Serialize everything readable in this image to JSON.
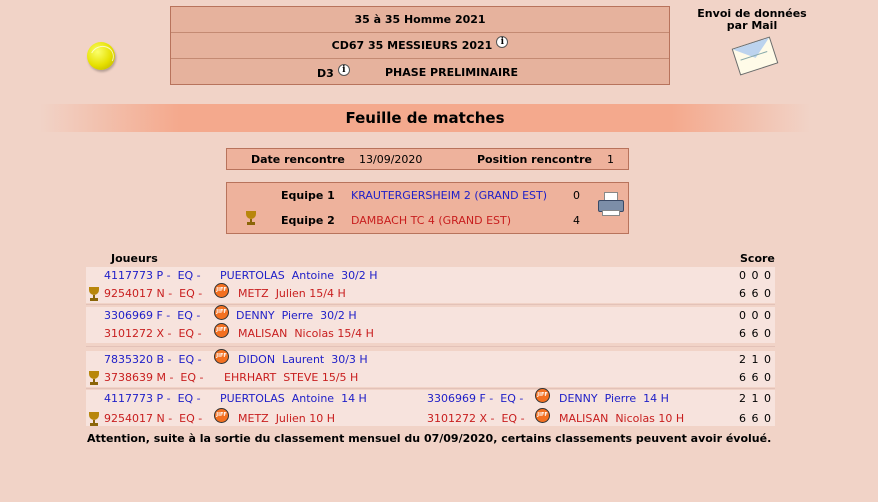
{
  "header": {
    "line1": "35  à 35  Homme  2021",
    "line2": "CD67 35 MESSIEURS 2021",
    "division": "D3",
    "phase": "PHASE PRELIMINAIRE",
    "info_glyph": "i"
  },
  "mail": {
    "label_line1": "Envoi de données",
    "label_line2": "par Mail"
  },
  "banner": {
    "title": "Feuille de matches"
  },
  "date_box": {
    "date_label": "Date rencontre",
    "date_value": "13/09/2020",
    "position_label": "Position rencontre",
    "position_value": "1"
  },
  "teams": [
    {
      "label": "Equipe 1",
      "name": "KRAUTERGERSHEIM 2 (GRAND EST)",
      "score": "0",
      "color": "#2020c8"
    },
    {
      "label": "Equipe 2",
      "name": "DAMBACH TC 4 (GRAND EST)",
      "score": "4",
      "color": "#c81e1e"
    }
  ],
  "table_headers": {
    "players": "Joueurs",
    "score": "Score"
  },
  "matches": [
    {
      "p1": {
        "id": "4117773 P -  EQ -",
        "name": "PUERTOLAS  Antoine  30/2 H",
        "score": "0 0 0"
      },
      "p2": {
        "id": "9254017 N -  EQ -",
        "name": "METZ  Julien 15/4 H",
        "score": "6 6 0"
      }
    },
    {
      "p1": {
        "id": "3306969 F -  EQ -",
        "name": "DENNY  Pierre  30/2 H",
        "score": "0 0 0"
      },
      "p2": {
        "id": "3101272 X -  EQ -",
        "name": "MALISAN  Nicolas 15/4 H",
        "score": "6 6 0"
      }
    },
    {
      "p1": {
        "id": "7835320 B -  EQ -",
        "name": "DIDON  Laurent  30/3 H",
        "score": "2 1 0"
      },
      "p2": {
        "id": "3738639 M -  EQ -",
        "name": "EHRHART  STEVE 15/5 H",
        "score": "6 6 0"
      }
    },
    {
      "p1": {
        "id": "4117773 P -  EQ -",
        "name": "PUERTOLAS  Antoine  14 H",
        "id_b": "3306969 F -  EQ -",
        "name_b": "DENNY  Pierre  14 H",
        "score": "2 1 0"
      },
      "p2": {
        "id": "9254017 N -  EQ -",
        "name": "METZ  Julien 10 H",
        "id_b": "3101272 X -  EQ -",
        "name_b": "MALISAN  Nicolas 10 H",
        "score": "6 6 0"
      }
    }
  ],
  "notice": "Attention, suite à la sortie du classement mensuel du 07/09/2020, certains classements peuvent avoir évolué.",
  "icons": {
    "tennis_ball": "tennis-ball-icon",
    "envelope": "mail-envelope-icon",
    "printer": "printer-icon",
    "trophy": "trophy-icon",
    "jiff": "jiff-logo-icon"
  }
}
